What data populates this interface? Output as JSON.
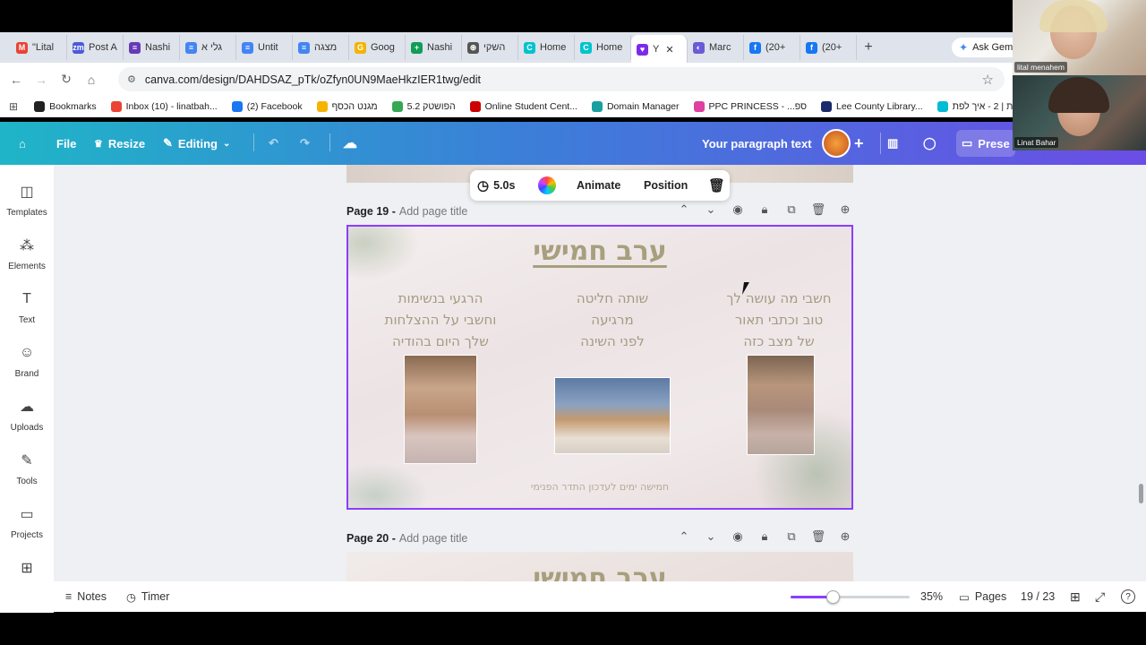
{
  "browser": {
    "tabs": [
      {
        "label": "\"Lital",
        "icon": "gmail-icon",
        "color": "#ea4335",
        "glyph": "M"
      },
      {
        "label": "Post A",
        "icon": "zoom-icon",
        "color": "#4a5ad8",
        "glyph": "zm"
      },
      {
        "label": "Nashi",
        "icon": "forms-icon",
        "color": "#673ab7",
        "glyph": "≡"
      },
      {
        "label": "גלי א",
        "icon": "docs-icon",
        "color": "#4285f4",
        "glyph": "≡"
      },
      {
        "label": "Untit",
        "icon": "docs-icon",
        "color": "#4285f4",
        "glyph": "≡"
      },
      {
        "label": "מצגה",
        "icon": "docs-icon",
        "color": "#4285f4",
        "glyph": "≡"
      },
      {
        "label": "Goog",
        "icon": "keep-icon",
        "color": "#f4b400",
        "glyph": "G"
      },
      {
        "label": "Nashi",
        "icon": "sheets-icon",
        "color": "#0f9d58",
        "glyph": "+"
      },
      {
        "label": "השקי",
        "icon": "chatgpt-icon",
        "color": "#555555",
        "glyph": "⊛"
      },
      {
        "label": "Home",
        "icon": "canva-icon",
        "color": "#00c4cc",
        "glyph": "C"
      },
      {
        "label": "Home",
        "icon": "canva-icon",
        "color": "#00c4cc",
        "glyph": "C"
      },
      {
        "label": "Y",
        "icon": "canva-design-icon",
        "color": "#7d2ae8",
        "glyph": "♥",
        "active": true
      },
      {
        "label": "Marc",
        "icon": "app-icon",
        "color": "#6b5bd6",
        "glyph": "◐"
      },
      {
        "label": "(20+",
        "icon": "facebook-icon",
        "color": "#1877f2",
        "glyph": "f"
      },
      {
        "label": "(20+",
        "icon": "facebook-icon",
        "color": "#1877f2",
        "glyph": "f"
      }
    ],
    "new_tab": "+",
    "ask_gemini": "Ask Gemi",
    "url": "canva.com/design/DAHDSAZ_pTk/oZfyn0UN9MaeHkzIER1twg/edit",
    "bookmarks": [
      {
        "label": "Bookmarks",
        "color": "#222222"
      },
      {
        "label": "Inbox (10) - linatbah...",
        "color": "#ea4335"
      },
      {
        "label": "(2) Facebook",
        "color": "#1877f2"
      },
      {
        "label": "מגנט הכסף",
        "color": "#f4b400"
      },
      {
        "label": "הפושטק 5.2",
        "color": "#34a853"
      },
      {
        "label": "Online Student Cent...",
        "color": "#cc0000"
      },
      {
        "label": "Domain Manager",
        "color": "#19a0a0"
      },
      {
        "label": "PPC PRINCESS - ...ספ",
        "color": "#e040a0"
      },
      {
        "label": "Lee County Library...",
        "color": "#1a2a6c"
      },
      {
        "label": "בלוגית | 2 - איך לפת...",
        "color": "#00bcd4"
      }
    ]
  },
  "canva": {
    "toolbar": {
      "file": "File",
      "resize": "Resize",
      "editing": "Editing",
      "doc_title": "Your paragraph text",
      "present": "Prese"
    },
    "sidebar": [
      {
        "label": "Templates",
        "icon": "templates-icon",
        "glyph": "◫"
      },
      {
        "label": "Elements",
        "icon": "elements-icon",
        "glyph": "⁂"
      },
      {
        "label": "Text",
        "icon": "text-icon",
        "glyph": "T"
      },
      {
        "label": "Brand",
        "icon": "brand-icon",
        "glyph": "☺"
      },
      {
        "label": "Uploads",
        "icon": "uploads-icon",
        "glyph": "☁"
      },
      {
        "label": "Tools",
        "icon": "tools-icon",
        "glyph": "✎"
      },
      {
        "label": "Projects",
        "icon": "projects-icon",
        "glyph": "▭"
      },
      {
        "label": "Apps",
        "icon": "apps-icon",
        "glyph": "⊞"
      }
    ],
    "float_toolbar": {
      "duration": "5.0s",
      "animate": "Animate",
      "position": "Position"
    },
    "page19": {
      "label": "Page 19 -",
      "title_placeholder": "Add page title"
    },
    "page20": {
      "label": "Page 20 -",
      "title_placeholder": "Add page title"
    },
    "slide": {
      "title": "ערב חמישי",
      "col_right": [
        "חשבי מה עושה לך",
        "טוב וכתבי תאור",
        "של מצב כזה"
      ],
      "col_middle": [
        "שותה חליטה",
        "מרגיעה",
        "לפני השינה"
      ],
      "col_left": [
        "הרגעי בנשימות",
        "וחשבי על ההצלחות",
        "שלך היום בהודיה"
      ],
      "footer": "חמישה ימים לעדכון התדר הפנימי"
    },
    "next_slide_title": "ערב חמישי",
    "bottom": {
      "notes": "Notes",
      "timer": "Timer",
      "zoom": "35%",
      "zoom_fraction": 0.35,
      "pages": "Pages",
      "page_count": "19 / 23"
    }
  },
  "webcam": {
    "participant1": "lital menahem",
    "participant2": "Linat Bahar"
  }
}
